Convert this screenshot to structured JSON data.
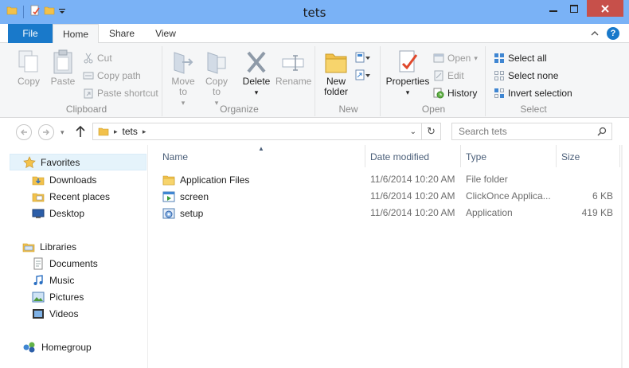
{
  "window": {
    "title": "tets"
  },
  "ribbon_tabs": [
    {
      "label": "File"
    },
    {
      "label": "Home"
    },
    {
      "label": "Share"
    },
    {
      "label": "View"
    }
  ],
  "ribbon": {
    "clipboard": {
      "label": "Clipboard",
      "copy": "Copy",
      "paste": "Paste",
      "cut": "Cut",
      "copy_path": "Copy path",
      "paste_shortcut": "Paste shortcut"
    },
    "organize": {
      "label": "Organize",
      "move_to": "Move to",
      "copy_to": "Copy to",
      "delete": "Delete",
      "rename": "Rename"
    },
    "new": {
      "label": "New",
      "new_folder": "New folder"
    },
    "open": {
      "label": "Open",
      "properties": "Properties",
      "open": "Open",
      "edit": "Edit",
      "history": "History"
    },
    "select": {
      "label": "Select",
      "select_all": "Select all",
      "select_none": "Select none",
      "invert_selection": "Invert selection"
    }
  },
  "address": {
    "segments": [
      "tets"
    ],
    "search_placeholder": "Search tets"
  },
  "nav_pane": {
    "favorites": {
      "label": "Favorites",
      "items": [
        "Downloads",
        "Recent places",
        "Desktop"
      ]
    },
    "libraries": {
      "label": "Libraries",
      "items": [
        "Documents",
        "Music",
        "Pictures",
        "Videos"
      ]
    },
    "homegroup": {
      "label": "Homegroup"
    }
  },
  "columns": {
    "name": "Name",
    "date_modified": "Date modified",
    "type": "Type",
    "size": "Size"
  },
  "files": [
    {
      "name": "Application Files",
      "date": "11/6/2014 10:20 AM",
      "type": "File folder",
      "size": "",
      "icon": "folder-icon"
    },
    {
      "name": "screen",
      "date": "11/6/2014 10:20 AM",
      "type": "ClickOnce Applica...",
      "size": "6 KB",
      "icon": "clickonce-icon"
    },
    {
      "name": "setup",
      "date": "11/6/2014 10:20 AM",
      "type": "Application",
      "size": "419 KB",
      "icon": "setup-icon"
    }
  ],
  "colors": {
    "titlebar": "#7ab2f6",
    "file_tab": "#1979ca",
    "close_button": "#c7504a",
    "selection": "#e5f3fb"
  }
}
